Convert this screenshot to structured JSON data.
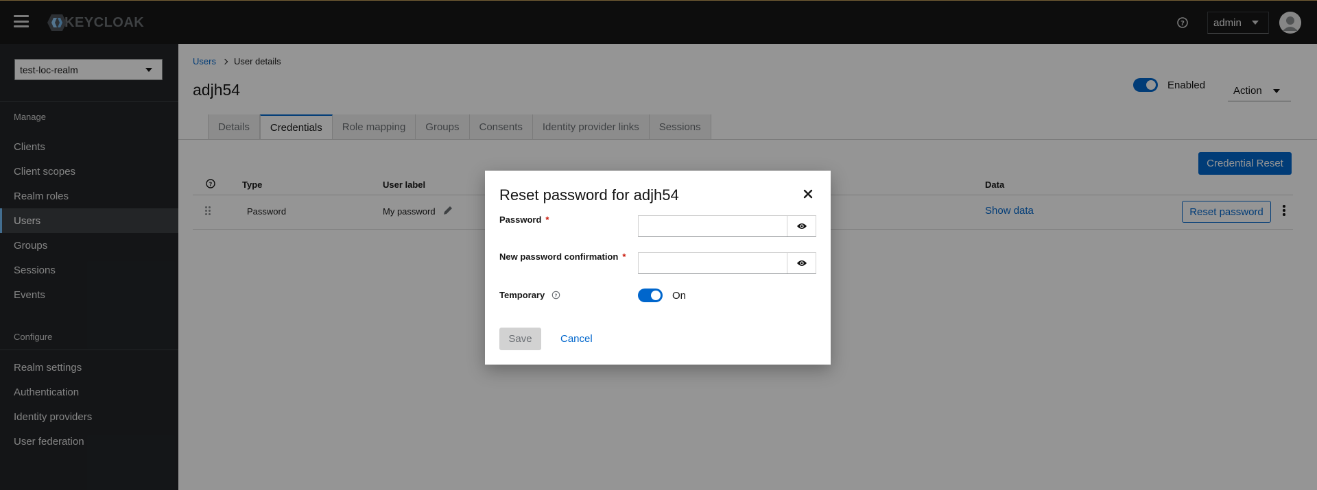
{
  "masthead": {
    "logo_text": "KEYCLOAK",
    "user_label": "admin",
    "accent_color": "#c9a35a"
  },
  "sidebar": {
    "realm": "test-loc-realm",
    "manage_heading": "Manage",
    "manage_items": [
      "Clients",
      "Client scopes",
      "Realm roles",
      "Users",
      "Groups",
      "Sessions",
      "Events"
    ],
    "active_item": "Users",
    "configure_heading": "Configure",
    "configure_items": [
      "Realm settings",
      "Authentication",
      "Identity providers",
      "User federation"
    ]
  },
  "main": {
    "breadcrumb": {
      "root": "Users",
      "current": "User details"
    },
    "title": "adjh54",
    "enabled_label": "Enabled",
    "enabled": true,
    "action_label": "Action",
    "tabs": [
      "Details",
      "Credentials",
      "Role mapping",
      "Groups",
      "Consents",
      "Identity provider links",
      "Sessions"
    ],
    "active_tab": "Credentials",
    "credential_reset_label": "Credential Reset",
    "table": {
      "headers": {
        "type": "Type",
        "user_label": "User label",
        "data": "Data"
      },
      "rows": [
        {
          "type": "Password",
          "user_label": "My password",
          "data": "Show data",
          "action": "Reset password"
        }
      ]
    }
  },
  "modal": {
    "title": "Reset password for adjh54",
    "password_label": "Password",
    "password_value": "",
    "confirm_label": "New password confirmation",
    "confirm_value": "",
    "required_marker": "*",
    "temporary_label": "Temporary",
    "temporary_state": "On",
    "save_label": "Save",
    "cancel_label": "Cancel"
  },
  "colors": {
    "primary": "#0066cc",
    "sidebar_bg": "#212427",
    "masthead_bg": "#151515",
    "required": "#c9190b"
  }
}
